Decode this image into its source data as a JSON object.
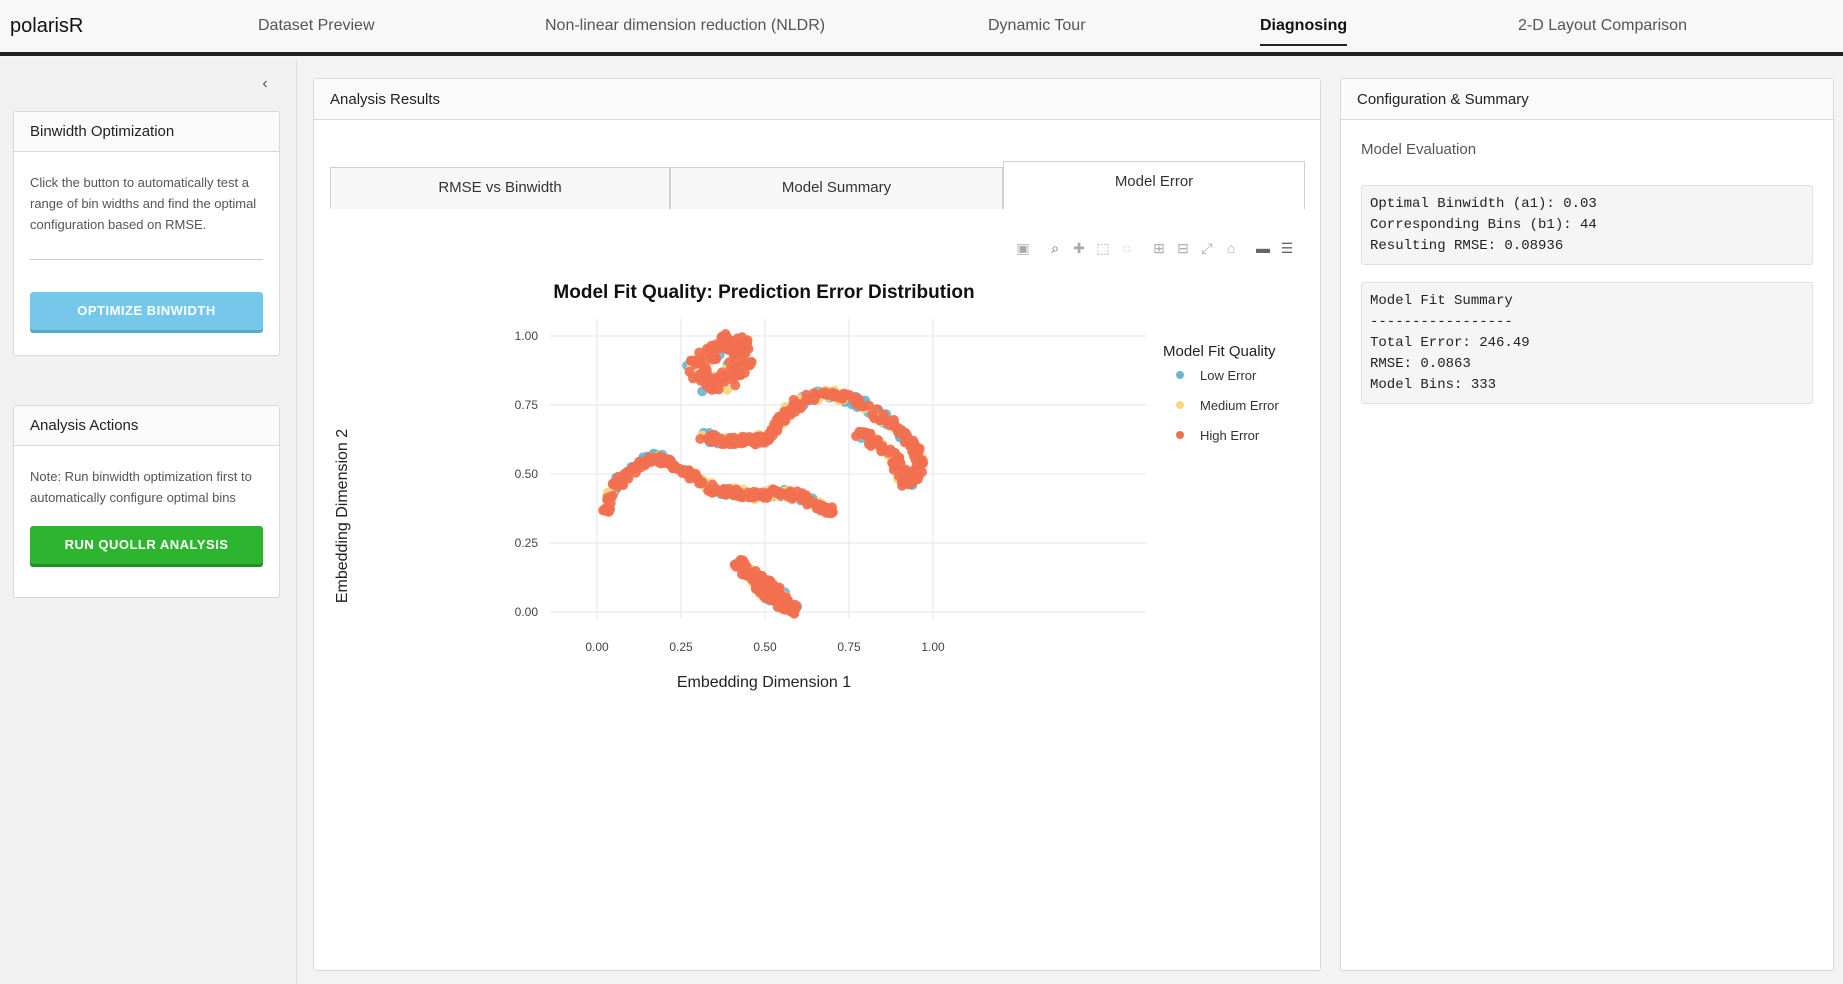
{
  "app": {
    "brand": "polarisR"
  },
  "nav": {
    "items": [
      {
        "label": "Dataset Preview"
      },
      {
        "label": "Non-linear dimension reduction (NLDR)"
      },
      {
        "label": "Dynamic Tour"
      },
      {
        "label": "Diagnosing"
      },
      {
        "label": "2-D Layout Comparison"
      }
    ],
    "active": "Diagnosing"
  },
  "sidebar": {
    "binwidth_card": {
      "title": "Binwidth Optimization",
      "description": "Click the button to automatically test a range of bin widths and find the optimal configuration based on RMSE.",
      "button_label": "OPTIMIZE BINWIDTH"
    },
    "actions_card": {
      "title": "Analysis Actions",
      "note": "Note: Run binwidth optimization first to automatically configure optimal bins",
      "button_label": "RUN QUOLLR ANALYSIS"
    }
  },
  "results": {
    "title": "Analysis Results",
    "tabs": [
      {
        "label": "RMSE vs Binwidth"
      },
      {
        "label": "Model Summary"
      },
      {
        "label": "Model Error"
      }
    ],
    "active_tab": "Model Error"
  },
  "summary": {
    "title": "Configuration & Summary",
    "eval_label": "Model Evaluation",
    "optimal_box": "Optimal Binwidth (a1): 0.03\nCorresponding Bins (b1): 44\nResulting RMSE: 0.08936",
    "fit_box": "Model Fit Summary\n-----------------\nTotal Error: 246.49\nRMSE: 0.0863\nModel Bins: 333"
  },
  "colors": {
    "low": "#6bb5d0",
    "medium": "#f8d77f",
    "high": "#f2704f"
  },
  "chart_data": {
    "type": "scatter",
    "title": "Model Fit Quality: Prediction Error Distribution",
    "xlabel": "Embedding Dimension 1",
    "ylabel": "Embedding Dimension 2",
    "xlim": [
      0,
      1
    ],
    "ylim": [
      0,
      1
    ],
    "x_ticks": [
      "0.00",
      "0.25",
      "0.50",
      "0.75",
      "1.00"
    ],
    "y_ticks": [
      "0.00",
      "0.25",
      "0.50",
      "0.75",
      "1.00"
    ],
    "grid": true,
    "legend_title": "Model Fit Quality",
    "legend_position": "right",
    "series": [
      {
        "name": "Low Error",
        "color": "#6bb5d0"
      },
      {
        "name": "Medium Error",
        "color": "#f8d77f"
      },
      {
        "name": "High Error",
        "color": "#f2704f"
      }
    ],
    "clusters": [
      {
        "path": [
          [
            0.28,
            0.87
          ],
          [
            0.32,
            0.92
          ],
          [
            0.36,
            0.96
          ],
          [
            0.4,
            0.98
          ],
          [
            0.43,
            0.96
          ],
          [
            0.44,
            0.9
          ],
          [
            0.4,
            0.85
          ],
          [
            0.35,
            0.82
          ],
          [
            0.3,
            0.84
          ]
        ],
        "spread": 0.03
      },
      {
        "path": [
          [
            0.32,
            0.64
          ],
          [
            0.37,
            0.62
          ],
          [
            0.42,
            0.62
          ],
          [
            0.47,
            0.62
          ],
          [
            0.52,
            0.64
          ],
          [
            0.55,
            0.7
          ],
          [
            0.59,
            0.75
          ],
          [
            0.64,
            0.78
          ],
          [
            0.7,
            0.79
          ],
          [
            0.76,
            0.77
          ],
          [
            0.82,
            0.73
          ],
          [
            0.88,
            0.68
          ],
          [
            0.93,
            0.62
          ],
          [
            0.96,
            0.55
          ],
          [
            0.95,
            0.5
          ],
          [
            0.92,
            0.47
          ],
          [
            0.9,
            0.52
          ],
          [
            0.87,
            0.58
          ],
          [
            0.82,
            0.62
          ],
          [
            0.78,
            0.65
          ]
        ],
        "spread": 0.015
      },
      {
        "path": [
          [
            0.02,
            0.36
          ],
          [
            0.04,
            0.42
          ],
          [
            0.07,
            0.48
          ],
          [
            0.12,
            0.53
          ],
          [
            0.17,
            0.56
          ],
          [
            0.22,
            0.54
          ],
          [
            0.27,
            0.5
          ],
          [
            0.32,
            0.46
          ],
          [
            0.37,
            0.44
          ],
          [
            0.42,
            0.43
          ],
          [
            0.47,
            0.42
          ],
          [
            0.52,
            0.43
          ],
          [
            0.57,
            0.43
          ],
          [
            0.62,
            0.41
          ],
          [
            0.67,
            0.38
          ],
          [
            0.7,
            0.36
          ]
        ],
        "spread": 0.015
      },
      {
        "path": [
          [
            0.42,
            0.18
          ],
          [
            0.45,
            0.15
          ],
          [
            0.48,
            0.12
          ],
          [
            0.51,
            0.09
          ],
          [
            0.54,
            0.06
          ],
          [
            0.57,
            0.03
          ],
          [
            0.58,
            0.01
          ],
          [
            0.52,
            0.05
          ],
          [
            0.47,
            0.1
          ]
        ],
        "spread": 0.018
      }
    ]
  }
}
